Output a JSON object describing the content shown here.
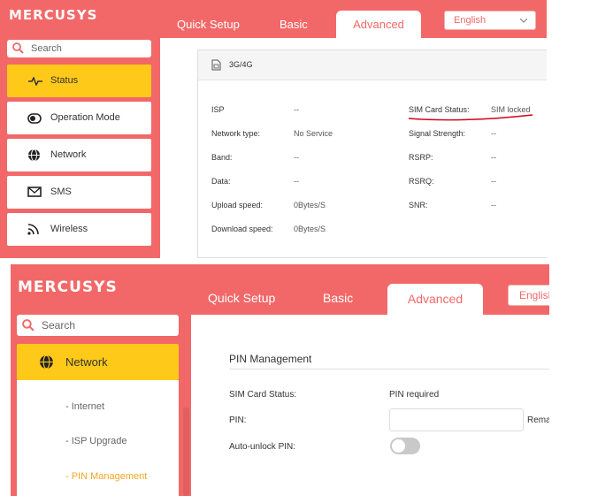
{
  "brand": {
    "logo_text": "MERCUSYS",
    "accent": "#f26868",
    "active_nav": "#ffc91a"
  },
  "screen1": {
    "tabs": [
      "Quick Setup",
      "Basic",
      "Advanced"
    ],
    "active_tab": "Advanced",
    "language": "English",
    "search_placeholder": "Search",
    "sidebar": [
      {
        "label": "Status",
        "icon": "pulse-icon",
        "active": true
      },
      {
        "label": "Operation Mode",
        "icon": "toggle-circle-icon",
        "active": false
      },
      {
        "label": "Network",
        "icon": "globe-icon",
        "active": false
      },
      {
        "label": "SMS",
        "icon": "envelope-icon",
        "active": false
      },
      {
        "label": "Wireless",
        "icon": "wifi-icon",
        "active": false
      }
    ],
    "card_title": "3G/4G",
    "left_fields": [
      {
        "label": "ISP",
        "value": "--"
      },
      {
        "label": "Network type:",
        "value": "No Service"
      },
      {
        "label": "Band:",
        "value": "--"
      },
      {
        "label": "Data:",
        "value": "--"
      },
      {
        "label": "Upload speed:",
        "value": "0Bytes/S"
      },
      {
        "label": "Download speed:",
        "value": "0Bytes/S"
      }
    ],
    "right_fields": [
      {
        "label": "SIM Card Status:",
        "value": "SIM locked"
      },
      {
        "label": "Signal Strength:",
        "value": "--"
      },
      {
        "label": "RSRP:",
        "value": "--"
      },
      {
        "label": "RSRQ:",
        "value": "--"
      },
      {
        "label": "SNR:",
        "value": "--"
      }
    ],
    "annotation_color": "#d0021b"
  },
  "screen2": {
    "tabs": [
      "Quick Setup",
      "Basic",
      "Advanced"
    ],
    "active_tab": "Advanced",
    "language": "English",
    "search_placeholder": "Search",
    "sidebar_parent": {
      "label": "Network",
      "icon": "globe-icon"
    },
    "sub_items": [
      {
        "label": "- Internet",
        "active": false
      },
      {
        "label": "- ISP Upgrade",
        "active": false
      },
      {
        "label": "- PIN Management",
        "active": true
      }
    ],
    "section_title": "PIN Management",
    "sim_status_label": "SIM Card Status:",
    "sim_status_value": "PIN required",
    "pin_label": "PIN:",
    "pin_value": "",
    "remaining_label": "Rema",
    "auto_unlock_label": "Auto-unlock PIN:",
    "auto_unlock_on": false
  }
}
